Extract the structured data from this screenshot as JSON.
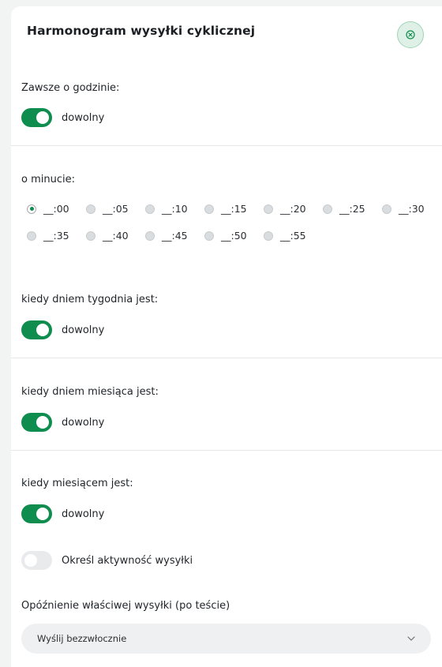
{
  "header": {
    "title": "Harmonogram wysyłki cyklicznej"
  },
  "hour": {
    "label": "Zawsze o godzinie:",
    "toggle_label": "dowolny",
    "toggle_on": true
  },
  "minute": {
    "label": "o minucie:",
    "options": [
      "__:00",
      "__:05",
      "__:10",
      "__:15",
      "__:20",
      "__:25",
      "__:30",
      "__:35",
      "__:40",
      "__:45",
      "__:50",
      "__:55"
    ],
    "selected": "__:00"
  },
  "weekday": {
    "label": "kiedy dniem tygodnia jest:",
    "toggle_label": "dowolny",
    "toggle_on": true
  },
  "monthday": {
    "label": "kiedy dniem miesiąca jest:",
    "toggle_label": "dowolny",
    "toggle_on": true
  },
  "month": {
    "label": "kiedy miesiącem jest:",
    "toggle_label": "dowolny",
    "toggle_on": true
  },
  "activity": {
    "toggle_label": "Określ aktywność wysyłki",
    "toggle_on": false
  },
  "delay": {
    "label": "Opóźnienie właściwej wysyłki (po teście)",
    "selected": "Wyślij bezzwłocznie"
  },
  "colors": {
    "accent": "#0f8d4f",
    "close_bg": "#dff1e7",
    "toggle_off": "#e8eaec"
  },
  "icons": {
    "close": "close-circle-icon",
    "dropdown": "chevron-down-icon"
  }
}
